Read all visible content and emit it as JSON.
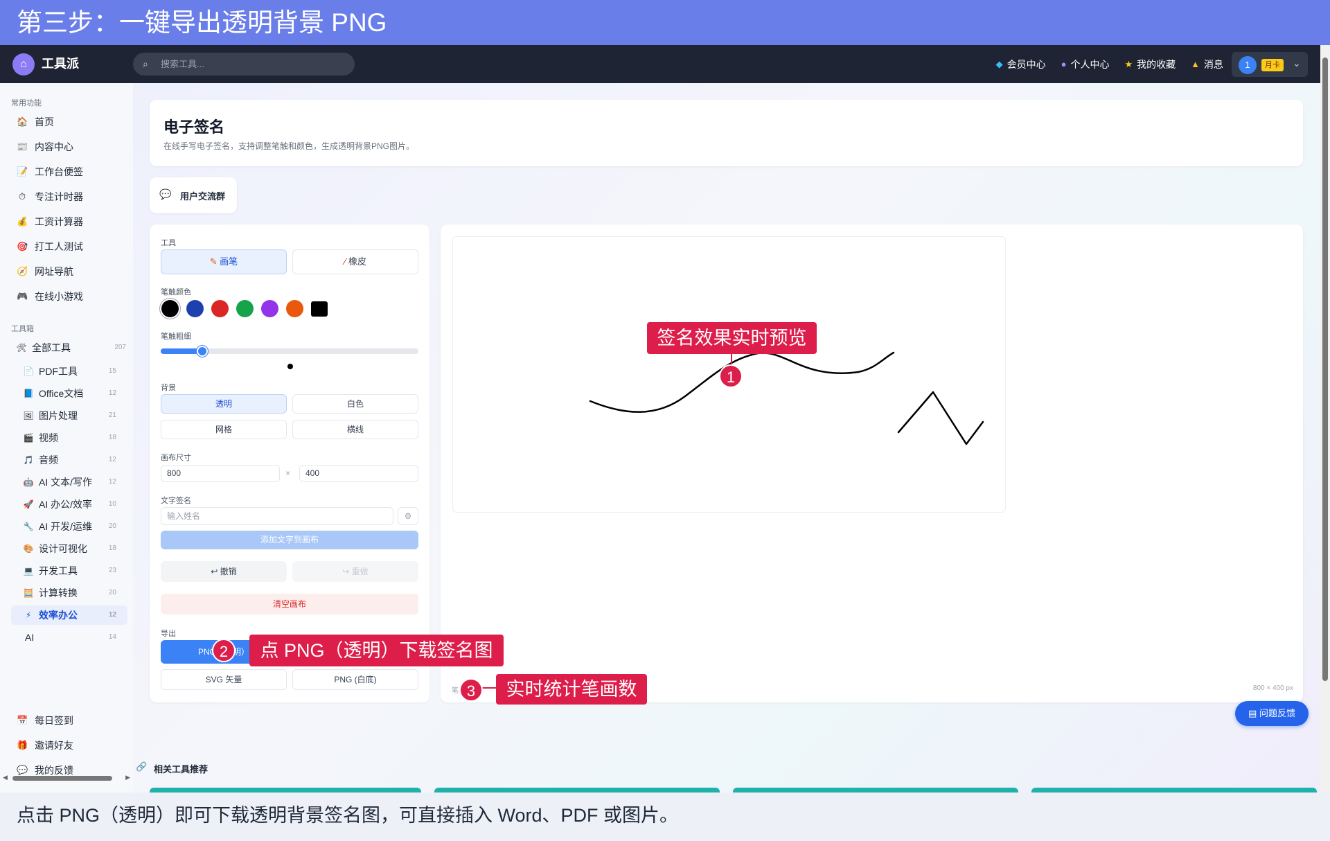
{
  "banner": {
    "top": "第三步：一键导出透明背景 PNG",
    "bottom": "点击 PNG（透明）即可下载透明背景签名图，可直接插入 Word、PDF 或图片。"
  },
  "navbar": {
    "brand": "工具派",
    "search_placeholder": "搜索工具...",
    "links": [
      {
        "label": "会员中心",
        "icon": "diamond-icon"
      },
      {
        "label": "个人中心",
        "icon": "user-icon"
      },
      {
        "label": "我的收藏",
        "icon": "star-icon"
      },
      {
        "label": "消息",
        "icon": "bell-icon"
      }
    ],
    "avatar": "1",
    "badge": "月卡"
  },
  "sidebar": {
    "common_title": "常用功能",
    "common": [
      {
        "label": "首页",
        "icon": "🏠"
      },
      {
        "label": "内容中心",
        "icon": "📰"
      },
      {
        "label": "工作台便签",
        "icon": "📝"
      },
      {
        "label": "专注计时器",
        "icon": "⏱"
      },
      {
        "label": "工资计算器",
        "icon": "💰"
      },
      {
        "label": "打工人测试",
        "icon": "🎯"
      },
      {
        "label": "网址导航",
        "icon": "🧭"
      },
      {
        "label": "在线小游戏",
        "icon": "🎮"
      }
    ],
    "toolbox_title": "工具箱",
    "all_tools": {
      "label": "全部工具",
      "count": "207",
      "icon": "🛠"
    },
    "tools": [
      {
        "label": "PDF工具",
        "count": "15",
        "icon": "📄"
      },
      {
        "label": "Office文档",
        "count": "12",
        "icon": "📘"
      },
      {
        "label": "图片处理",
        "count": "21",
        "icon": "🖼"
      },
      {
        "label": "视频",
        "count": "18",
        "icon": "🎬"
      },
      {
        "label": "音频",
        "count": "12",
        "icon": "🎵"
      },
      {
        "label": "AI 文本/写作",
        "count": "12",
        "icon": "🤖"
      },
      {
        "label": "AI 办公/效率",
        "count": "10",
        "icon": "🚀"
      },
      {
        "label": "AI 开发/运维",
        "count": "20",
        "icon": "🔧"
      },
      {
        "label": "设计可视化",
        "count": "18",
        "icon": "🎨"
      },
      {
        "label": "开发工具",
        "count": "23",
        "icon": "💻"
      },
      {
        "label": "计算转换",
        "count": "20",
        "icon": "🧮"
      },
      {
        "label": "效率办公",
        "count": "12",
        "icon": "⚡"
      },
      {
        "label": "AI",
        "count": "14",
        "icon": ""
      }
    ],
    "bottom": [
      {
        "label": "每日签到",
        "icon": "📅"
      },
      {
        "label": "邀请好友",
        "icon": "🎁"
      },
      {
        "label": "我的反馈",
        "icon": "💬"
      }
    ]
  },
  "page": {
    "title": "电子签名",
    "description": "在线手写电子签名，支持调整笔触和颜色，生成透明背景PNG图片。",
    "group_button": "用户交流群"
  },
  "panel": {
    "tool_label": "工具",
    "pen": "画笔",
    "eraser": "橡皮",
    "color_label": "笔触颜色",
    "colors": [
      "#000000",
      "#1e40af",
      "#dc2626",
      "#16a34a",
      "#9333ea",
      "#ea580c",
      "#000000"
    ],
    "width_label": "笔触粗细",
    "width_value": 0.16,
    "bg_label": "背景",
    "bg_options": [
      "透明",
      "白色",
      "网格",
      "横线"
    ],
    "size_label": "画布尺寸",
    "width_input": "800",
    "height_input": "400",
    "times": "×",
    "text_label": "文字签名",
    "text_placeholder": "输入姓名",
    "add_text": "添加文字到画布",
    "undo": "↩ 撤销",
    "redo": "↪ 重做",
    "clear": "清空画布",
    "export_label": "导出",
    "export_png_transparent": "PNG（透明）",
    "export_svg": "SVG 矢量",
    "export_png_white": "PNG (白底)"
  },
  "canvas": {
    "dims": "800 × 400 px",
    "stroke_count_prefix": "笔"
  },
  "feedback": "问题反馈",
  "related": "相关工具推荐",
  "callouts": {
    "c1": "签名效果实时预览",
    "c2": "点 PNG（透明）下载签名图",
    "c3": "实时统计笔画数",
    "n1": "1",
    "n2": "2",
    "n3": "3"
  }
}
